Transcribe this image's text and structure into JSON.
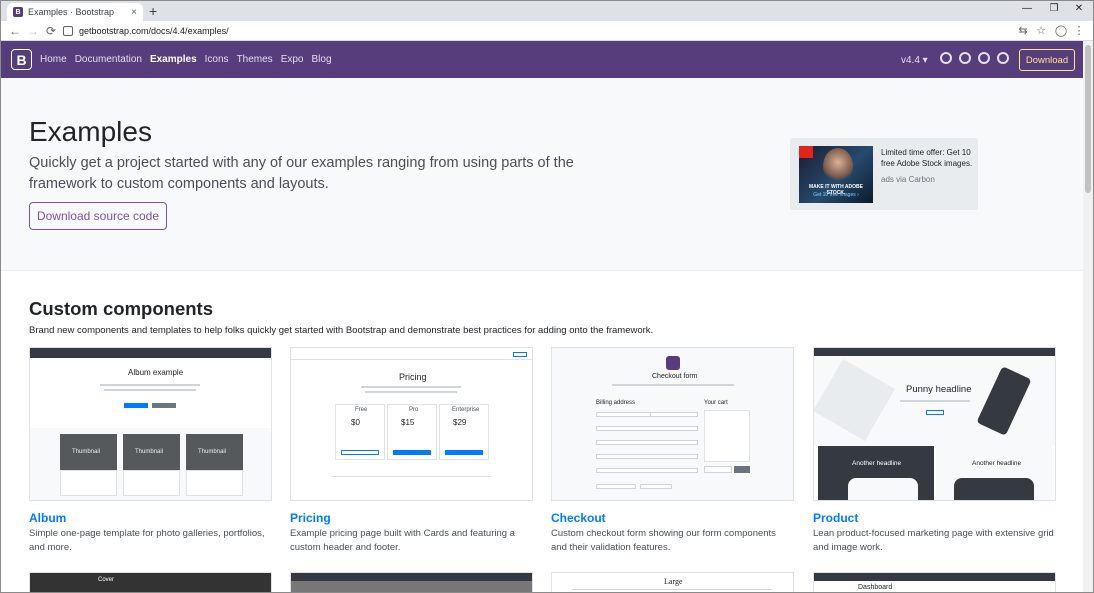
{
  "browser": {
    "tab_title": "Examples · Bootstrap",
    "tab_close": "×",
    "new_tab": "+",
    "url": "getbootstrap.com/docs/4.4/examples/",
    "back": "←",
    "forward": "→",
    "reload": "⟳",
    "minimize": "—",
    "restore": "❐",
    "close": "✕",
    "translate": "⇆",
    "bookmark": "☆",
    "account": "◯",
    "menu": "⋮"
  },
  "navbar": {
    "brand": "B",
    "links": [
      "Home",
      "Documentation",
      "Examples",
      "Icons",
      "Themes",
      "Expo",
      "Blog"
    ],
    "active": "Examples",
    "version": "v4.4 ▾",
    "download": "Download"
  },
  "masthead": {
    "title": "Examples",
    "lead": "Quickly get a project started with any of our examples ranging from using parts of the framework to custom components and layouts.",
    "button": "Download source code"
  },
  "ad": {
    "text": "Limited time offer: Get 10 free Adobe Stock images.",
    "via": "ads via Carbon",
    "img_line1": "MAKE IT WITH ADOBE STOCK.",
    "img_line2": "Get 10 free images ›"
  },
  "section": {
    "title": "Custom components",
    "description": "Brand new components and templates to help folks quickly get started with Bootstrap and demonstrate best practices for adding onto the framework."
  },
  "cards": [
    {
      "title": "Album",
      "description": "Simple one-page template for photo galleries, portfolios, and more."
    },
    {
      "title": "Pricing",
      "description": "Example pricing page built with Cards and featuring a custom header and footer."
    },
    {
      "title": "Checkout",
      "description": "Custom checkout form showing our form components and their validation features."
    },
    {
      "title": "Product",
      "description": "Lean product-focused marketing page with extensive grid and image work."
    }
  ],
  "previews": {
    "album_heading": "Album example",
    "thumbnail": "Thumbnail",
    "pricing_heading": "Pricing",
    "pricing_plans": [
      "Free",
      "Pro",
      "Enterprise"
    ],
    "pricing_prices": [
      "$0",
      "$15",
      "$29"
    ],
    "checkout_heading": "Checkout form",
    "billing": "Billing address",
    "cart": "Your cart",
    "product_heading": "Punny headline",
    "another_headline": "Another headline",
    "cover_title": "Cover",
    "blog_title": "Large",
    "dashboard_title": "Dashboard"
  }
}
